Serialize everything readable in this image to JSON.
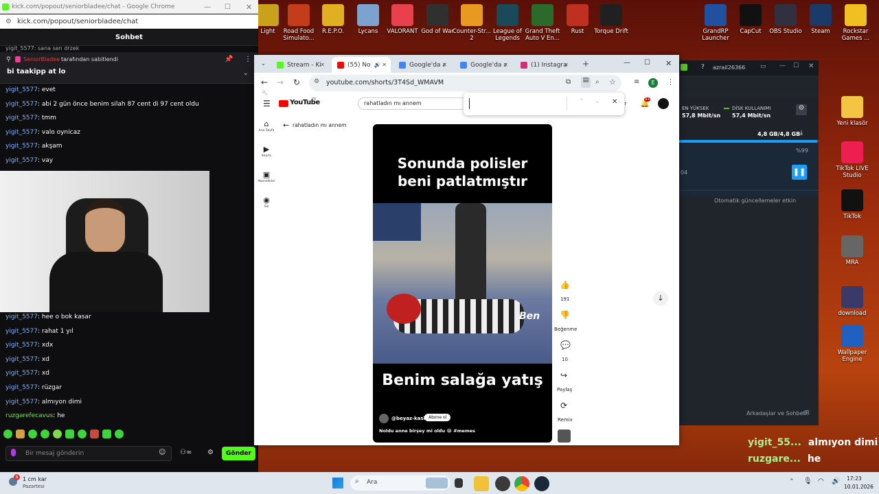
{
  "desktop_top_icons": [
    {
      "label": "Light",
      "color": "#c9a21a"
    },
    {
      "label": "Road Food Simulato...",
      "color": "#c43d1a"
    },
    {
      "label": "R.E.P.O.",
      "color": "#e0b020"
    },
    {
      "label": "Lycans",
      "color": "#7ca3d0"
    },
    {
      "label": "VALORANT",
      "color": "#e8404c"
    },
    {
      "label": "God of War",
      "color": "#303030"
    },
    {
      "label": "Counter-Str... 2",
      "color": "#e89a20"
    },
    {
      "label": "League of Legends",
      "color": "#1a4a5a"
    },
    {
      "label": "Grand Theft Auto V En...",
      "color": "#2a6a2a"
    },
    {
      "label": "Rust",
      "color": "#c03020"
    },
    {
      "label": "Torque Drift",
      "color": "#202020"
    },
    {
      "label": "GrandRP Launcher",
      "color": "#2050a0"
    },
    {
      "label": "CapCut",
      "color": "#111111"
    },
    {
      "label": "OBS Studio",
      "color": "#303040"
    },
    {
      "label": "Steam",
      "color": "#1a3a6a"
    },
    {
      "label": "Rockstar Games ...",
      "color": "#f0c020"
    }
  ],
  "desktop_side_icons": [
    {
      "label": "Yeni klasör",
      "color": "#f4c542"
    },
    {
      "label": "TikTok LIVE Studio",
      "color": "#ee1d52"
    },
    {
      "label": "TikTok",
      "color": "#111111"
    },
    {
      "label": "MRA",
      "color": "#666666"
    },
    {
      "label": "download",
      "color": "#3a3a6a"
    },
    {
      "label": "Wallpaper Engine",
      "color": "#2060c0"
    }
  ],
  "chat_window": {
    "title": "kick.com/popout/seniorbladee/chat - Google Chrome",
    "url": "kick.com/popout/seniorbladee/chat",
    "header": "Sohbet",
    "pinned_by": "SeniorBladee",
    "pinned_suffix": "tarafından sabitlendi",
    "pinned_text": "bi taakipp at lo",
    "partial_top": "yigit_5577: sana sen drzek",
    "messages_top": [
      {
        "user": "yigit_5577",
        "text": "evet"
      },
      {
        "user": "yigit_5577",
        "text": "abi 2 gün önce benim silah 87 cent di 97 cent oldu"
      },
      {
        "user": "yigit_5577",
        "text": "tmm"
      },
      {
        "user": "yigit_5577",
        "text": "valo oynicaz"
      },
      {
        "user": "yigit_5577",
        "text": "akşam"
      },
      {
        "user": "yigit_5577",
        "text": "vay"
      }
    ],
    "messages_bottom": [
      {
        "user": "yigit_5577",
        "text": "hee o bok kasar"
      },
      {
        "user": "yigit_5577",
        "text": "rahat 1 yıl"
      },
      {
        "user": "yigit_5577",
        "text": "xdx"
      },
      {
        "user": "yigit_5577",
        "text": "xd"
      },
      {
        "user": "yigit_5577",
        "text": "xd"
      },
      {
        "user": "yigit_5577",
        "text": "rüzgar"
      },
      {
        "user": "yigit_5577",
        "text": "almıyon dimi"
      },
      {
        "user": "ruzgarefecavus",
        "text": "he"
      }
    ],
    "input_placeholder": "Bir mesaj gönderin",
    "send_label": "Gönder"
  },
  "browser": {
    "tabs": [
      {
        "label": "Stream - Ki",
        "color": "#53fc18"
      },
      {
        "label": "(55) No",
        "color": "#ff0000"
      },
      {
        "label": "Google'da a",
        "color": "#4285f4"
      },
      {
        "label": "Google'da a",
        "color": "#4285f4"
      },
      {
        "label": "(1) Instagra",
        "color": "#d62976"
      }
    ],
    "url": "youtube.com/shorts/3T4Sd_WMAVM",
    "profile_letter": "E",
    "find_value": "",
    "youtube": {
      "logo": "YouTube",
      "logo_sup": "TR",
      "search": "rahatladın mı annem",
      "back_title": "rahatladın mı annem",
      "nav": [
        {
          "label": "Ana Sayfa"
        },
        {
          "label": "Shorts"
        },
        {
          "label": "Abonelikler"
        },
        {
          "label": "Siz"
        }
      ],
      "notif_count": "9+",
      "video_top": "Sonunda polisler beni patlatmıştır",
      "video_mid": "Ben",
      "video_bottom": "Benim salağa yatış",
      "channel": "@beyaz-kask",
      "subscribe": "Abone ol",
      "caption": "Noldu anne birşey mi oldu 😂 #memes",
      "likes": "191",
      "dislike_label": "Beğenme",
      "comments": "10",
      "share_label": "Paylaş",
      "remix_label": "Remix",
      "partial_text": "ur"
    }
  },
  "right_app": {
    "user": "azrail26366",
    "stat1_label": "EN YÜKSEK",
    "stat1_value": "57,8 Mbit/sn",
    "stat2_label": "DİSK KULLANIMI",
    "stat2_value": "57,4 Mbit/sn",
    "size": "4,8 GB/4,8 GB",
    "percent": "%99",
    "side_num": "04",
    "updates": "Otomatik güncellemeler etkin",
    "friends": "Arkadaşlar ve Sohbet"
  },
  "overlay_chat": [
    {
      "user": "yigit_55...",
      "text": "almıyon dimi"
    },
    {
      "user": "ruzgare...",
      "text": "he"
    }
  ],
  "taskbar": {
    "weather": "1 cm kar",
    "day": "Pazartesi",
    "weather_badge": "6",
    "search": "Ara",
    "time": "17:23",
    "date": "10.01.2026"
  }
}
